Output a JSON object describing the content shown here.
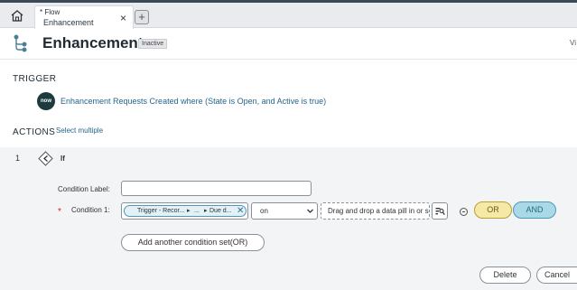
{
  "tab": {
    "flow_type": "* Flow",
    "name": "Enhancement",
    "close_glyph": "×"
  },
  "add_tab_glyph": "+",
  "header": {
    "title": "Enhancement",
    "status": "Inactive",
    "right_edge_text": "Vi"
  },
  "trigger": {
    "heading": "TRIGGER",
    "logo_text": "now",
    "description": "Enhancement Requests Created where (State is Open, and Active is true)"
  },
  "actions": {
    "heading": "ACTIONS",
    "select_multiple": "Select multiple"
  },
  "step": {
    "number": "1",
    "label": "If",
    "condition_label_text": "Condition Label:",
    "condition_label_value": "",
    "required_mark": "*",
    "condition1_label": "Condition 1:",
    "pill": {
      "segment1": "Trigger - Recor...",
      "arrow": "▸",
      "segment2": "...",
      "segment3": "Due d...",
      "remove_glyph": "✕"
    },
    "operator": "on",
    "dropzone_text": "Drag and drop a data pill in or select a date",
    "or_label": "OR",
    "and_label": "AND",
    "add_condition_set": "Add another condition set(OR)",
    "delete_label": "Delete",
    "cancel_label": "Cancel"
  },
  "icons": {
    "home": "home-icon",
    "flow": "flow-branch-icon",
    "if": "if-decision-icon",
    "chevron": "chevron-down-icon",
    "picker": "data-pill-picker-icon",
    "remove_condition": "minus-circle-icon"
  },
  "colors": {
    "link": "#24658f",
    "or_fill": "#f6e9a8",
    "and_fill": "#a9d8e6",
    "required": "#c8262c",
    "panel_bg": "#f3f4f5"
  }
}
